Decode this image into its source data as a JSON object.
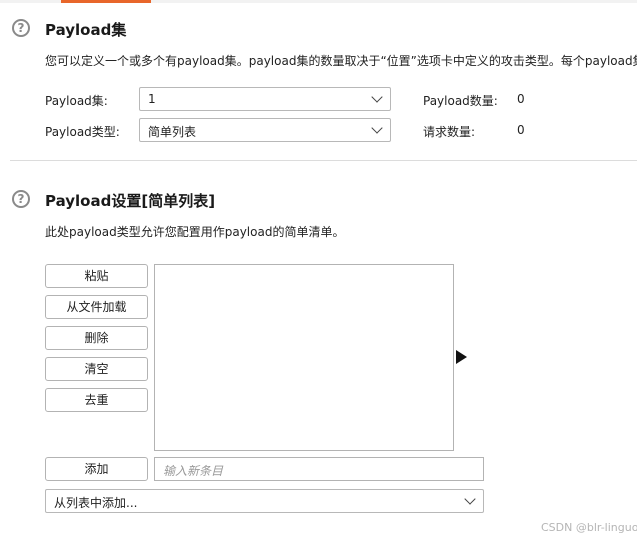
{
  "section1": {
    "help_icon": "question-circle-icon",
    "title": "Payload集",
    "description": "您可以定义一个或多个有payload集。payload集的数量取决于“位置”选项卡中定义的攻击类型。每个payload集",
    "payload_set_label": "Payload集:",
    "payload_set_value": "1",
    "payload_type_label": "Payload类型:",
    "payload_type_value": "简单列表",
    "payload_count_label": "Payload数量:",
    "payload_count_value": "0",
    "request_count_label": "请求数量:",
    "request_count_value": "0"
  },
  "section2": {
    "help_icon": "question-circle-icon",
    "title": "Payload设置[简单列表]",
    "description": "此处payload类型允许您配置用作payload的简单清单。",
    "buttons": {
      "paste": "粘贴",
      "load": "从文件加载",
      "remove": "删除",
      "clear": "清空",
      "dedupe": "去重",
      "add": "添加"
    },
    "list_items": [],
    "new_item_placeholder": "输入新条目",
    "add_from_list_value": "从列表中添加..."
  },
  "watermark": "CSDN @blr-linguo"
}
